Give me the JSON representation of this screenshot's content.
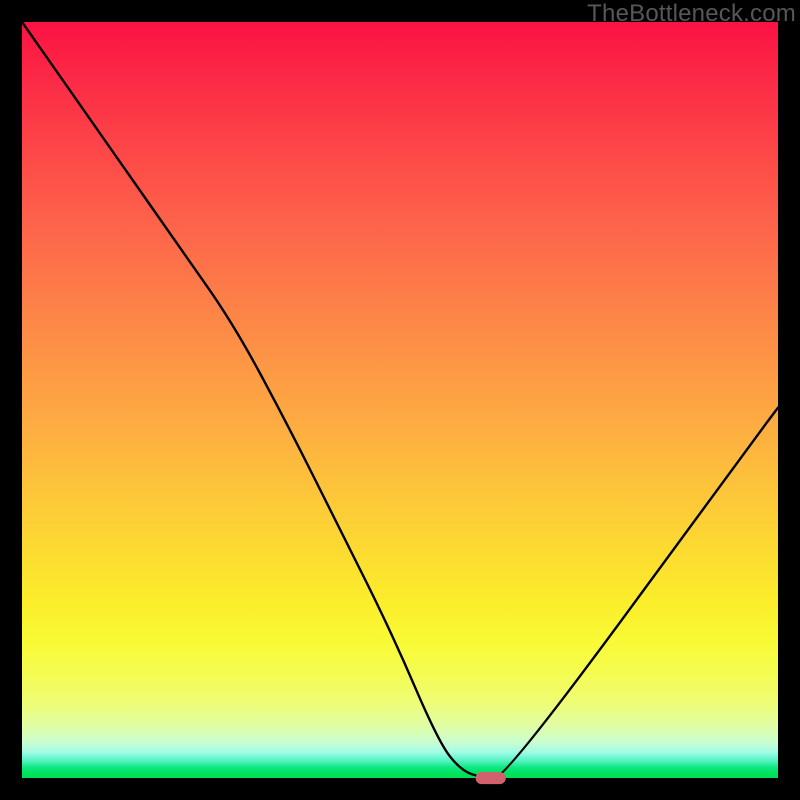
{
  "watermark": "TheBottleneck.com",
  "chart_data": {
    "type": "line",
    "title": "",
    "xlabel": "",
    "ylabel": "",
    "xlim": [
      0,
      100
    ],
    "ylim": [
      0,
      100
    ],
    "grid": false,
    "legend": false,
    "series": [
      {
        "name": "bottleneck-curve",
        "color": "#000000",
        "x": [
          0,
          7,
          14,
          21,
          28,
          35,
          42,
          49,
          55,
          58,
          61,
          64,
          97,
          100
        ],
        "values": [
          100,
          90,
          80,
          70,
          60,
          47,
          33,
          19,
          5,
          1,
          0,
          0,
          45,
          49
        ]
      }
    ],
    "marker": {
      "name": "optimal-point",
      "x": 62,
      "y": 0,
      "width_pct": 4.0,
      "height_pct": 1.6,
      "color": "#d1616d"
    },
    "background": {
      "type": "vertical-gradient",
      "stops": [
        {
          "pct": 0,
          "color": "#fb1243"
        },
        {
          "pct": 50,
          "color": "#fda643"
        },
        {
          "pct": 80,
          "color": "#faf62f"
        },
        {
          "pct": 94,
          "color": "#d8fdba"
        },
        {
          "pct": 100,
          "color": "#00df53"
        }
      ]
    }
  }
}
